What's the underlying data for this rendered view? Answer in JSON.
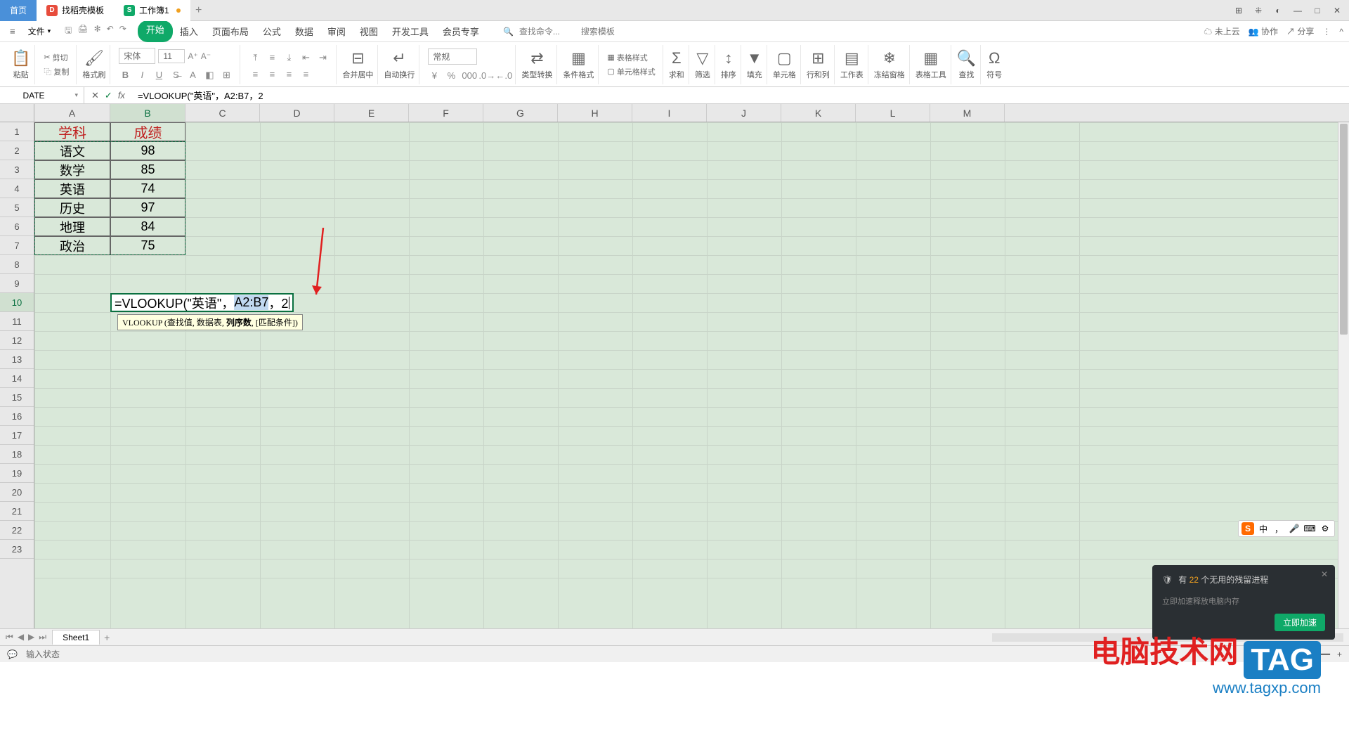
{
  "titlebar": {
    "home": "首页",
    "template": "找稻壳模板",
    "workbook": "工作簿1"
  },
  "menubar": {
    "file": "文件",
    "tabs": [
      "开始",
      "插入",
      "页面布局",
      "公式",
      "数据",
      "审阅",
      "视图",
      "开发工具",
      "会员专享"
    ],
    "search_cmd": "查找命令...",
    "search_tpl": "搜索模板",
    "cloud": "未上云",
    "coop": "协作",
    "share": "分享"
  },
  "ribbon": {
    "paste": "粘贴",
    "cut": "剪切",
    "copy": "复制",
    "format_painter": "格式刷",
    "font_name": "宋体",
    "font_size": "11",
    "merge": "合并居中",
    "wrap": "自动换行",
    "general": "常规",
    "type_convert": "类型转换",
    "cond_format": "条件格式",
    "table_style": "表格样式",
    "cell_style": "单元格样式",
    "sum": "求和",
    "filter": "筛选",
    "sort": "排序",
    "fill": "填充",
    "cell": "单元格",
    "row_col": "行和列",
    "worksheet": "工作表",
    "freeze": "冻结窗格",
    "table_tool": "表格工具",
    "find": "查找",
    "symbol": "符号"
  },
  "formula_bar": {
    "name_box": "DATE",
    "value": "=VLOOKUP(\"英语\"，A2:B7，2"
  },
  "columns": [
    "A",
    "B",
    "C",
    "D",
    "E",
    "F",
    "G",
    "H",
    "I",
    "J",
    "K",
    "L",
    "M"
  ],
  "table": {
    "header": [
      "学科",
      "成绩"
    ],
    "rows": [
      [
        "语文",
        "98"
      ],
      [
        "数学",
        "85"
      ],
      [
        "英语",
        "74"
      ],
      [
        "历史",
        "97"
      ],
      [
        "地理",
        "84"
      ],
      [
        "政治",
        "75"
      ]
    ]
  },
  "active_formula": {
    "prefix": "=VLOOKUP(\"英语\"，",
    "ref": "A2:B7",
    "suffix": "，2"
  },
  "tooltip": {
    "fn": "VLOOKUP",
    "p1": "(查找值,",
    "p2": "数据表,",
    "p3": "列序数",
    "p4": ", [匹配条件])"
  },
  "sheet": {
    "name": "Sheet1"
  },
  "status": {
    "edit": "输入状态"
  },
  "notify": {
    "prefix": "有",
    "count": "22",
    "suffix": "个无用的残留进程",
    "sub": "立即加速释放电脑内存",
    "btn": "立即加速"
  },
  "ime": {
    "s": "S",
    "zh": "中",
    "comma": "，"
  },
  "watermark": {
    "t1": "电脑技术网",
    "tag": "TAG",
    "t2": "www.tagxp.com"
  }
}
